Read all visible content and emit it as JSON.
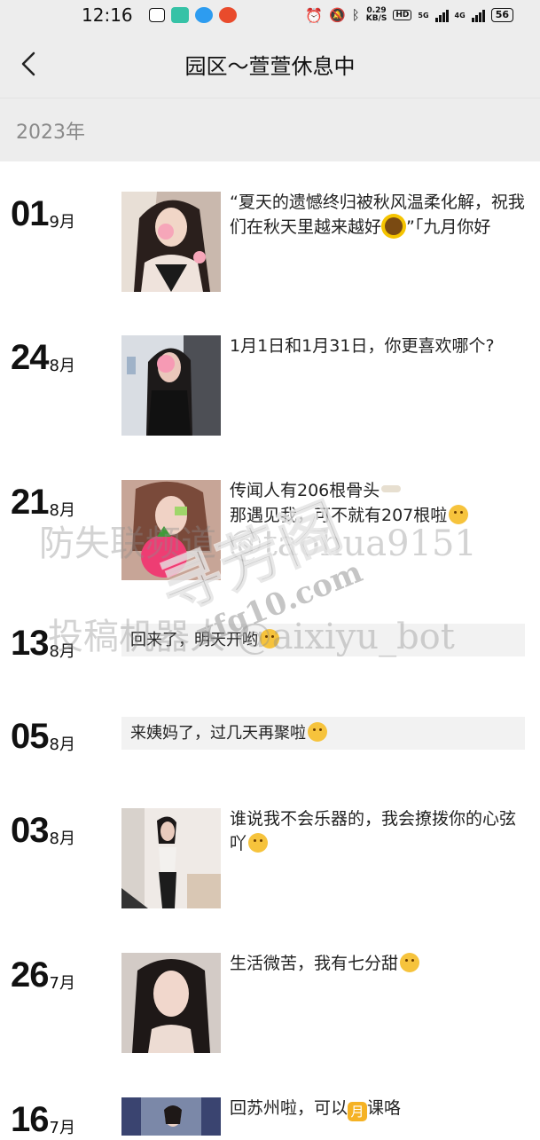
{
  "status_bar": {
    "time": "12:16",
    "speed_value": "0.29",
    "speed_unit": "KB/S",
    "hd": "HD",
    "net_5g": "5G",
    "net_4g": "4G",
    "battery": "56"
  },
  "header": {
    "back_icon": "chevron-left-icon",
    "title": "园区～萱萱休息中"
  },
  "year": "2023年",
  "posts": [
    {
      "day": "01",
      "month": "9月",
      "text": "“夏天的遗憾终归被秋风温柔化解，祝我们在秋天里越来越好",
      "text_tail": "”「九月你好",
      "has_image": true
    },
    {
      "day": "24",
      "month": "8月",
      "text": "1月1日和1月31日，你更喜欢哪个?",
      "has_image": true
    },
    {
      "day": "21",
      "month": "8月",
      "text": "传闻人有206根骨头",
      "text2": "那遇见我，可不就有207根啦",
      "has_image": true
    },
    {
      "day": "13",
      "month": "8月",
      "text": "回来了，明天开哟",
      "has_image": false
    },
    {
      "day": "05",
      "month": "8月",
      "text": "来姨妈了，过几天再聚啦",
      "has_image": false
    },
    {
      "day": "03",
      "month": "8月",
      "text": "谁说我不会乐器的，我会撩拨你的心弦吖",
      "has_image": true
    },
    {
      "day": "26",
      "month": "7月",
      "text": "生活微苦，我有七分甜",
      "has_image": true
    },
    {
      "day": "16",
      "month": "7月",
      "text": "回苏州啦，可以",
      "text_mid": "月",
      "text_tail": "课咯",
      "has_image": true
    }
  ],
  "watermarks": {
    "line1": "防失联频道 @taohua9151",
    "line2": "投稿机器人 @aixiyu_bot",
    "stamp_big": "寻芳阁",
    "stamp_small": "xfg10.com"
  },
  "colors": {
    "bar_bg": "#ededed",
    "year_text": "#8a8a8a",
    "text_card_bg": "#f2f2f2"
  }
}
